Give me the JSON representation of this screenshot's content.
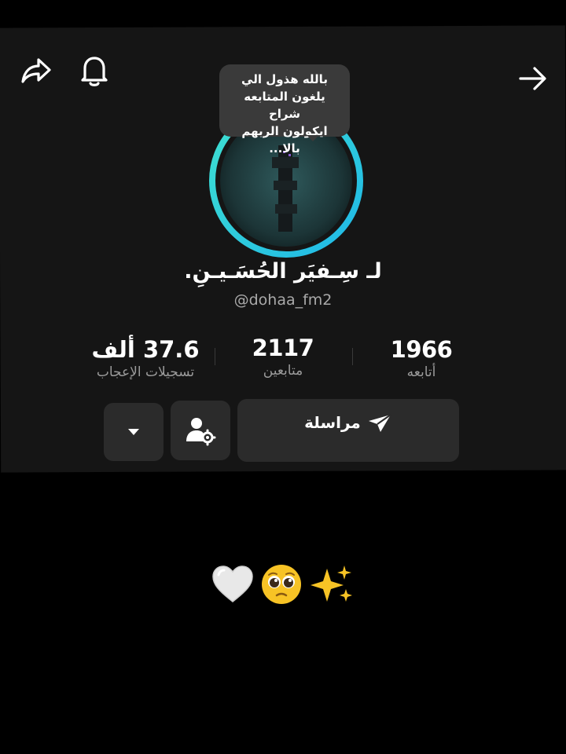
{
  "header": {
    "share_icon": "share-arrow-icon",
    "bell_icon": "bell-icon",
    "forward_icon": "arrow-right-icon"
  },
  "note_bubble": {
    "line1": "بالله هذول الي",
    "line2": "يلغون المتابعه شراح",
    "line3": "ايكولون الربهم بالا..."
  },
  "profile": {
    "display_name": "لـ سِـفيَر الحُسَـيـنِ.",
    "username": "@dohaa_fm2",
    "ring_colors": [
      "#3fe0d0",
      "#1fb8e8"
    ]
  },
  "stats": {
    "following": {
      "value": "1966",
      "label": "أتابعه"
    },
    "followers": {
      "value": "2117",
      "label": "متابعين"
    },
    "likes": {
      "value": "37.6 ألف",
      "label": "تسجيلات الإعجاب"
    }
  },
  "actions": {
    "message_label": "مراسلة",
    "message_icon": "paper-plane-icon",
    "user_settings_icon": "user-gear-icon",
    "dropdown_icon": "caret-down-icon"
  },
  "bio": {
    "emojis": "✨🥹🤍"
  },
  "colors": {
    "panel_bg": "#151515",
    "button_bg": "#2b2b2b",
    "ring_gradient_start": "#3fe0d0",
    "ring_gradient_end": "#1fb8e8"
  }
}
